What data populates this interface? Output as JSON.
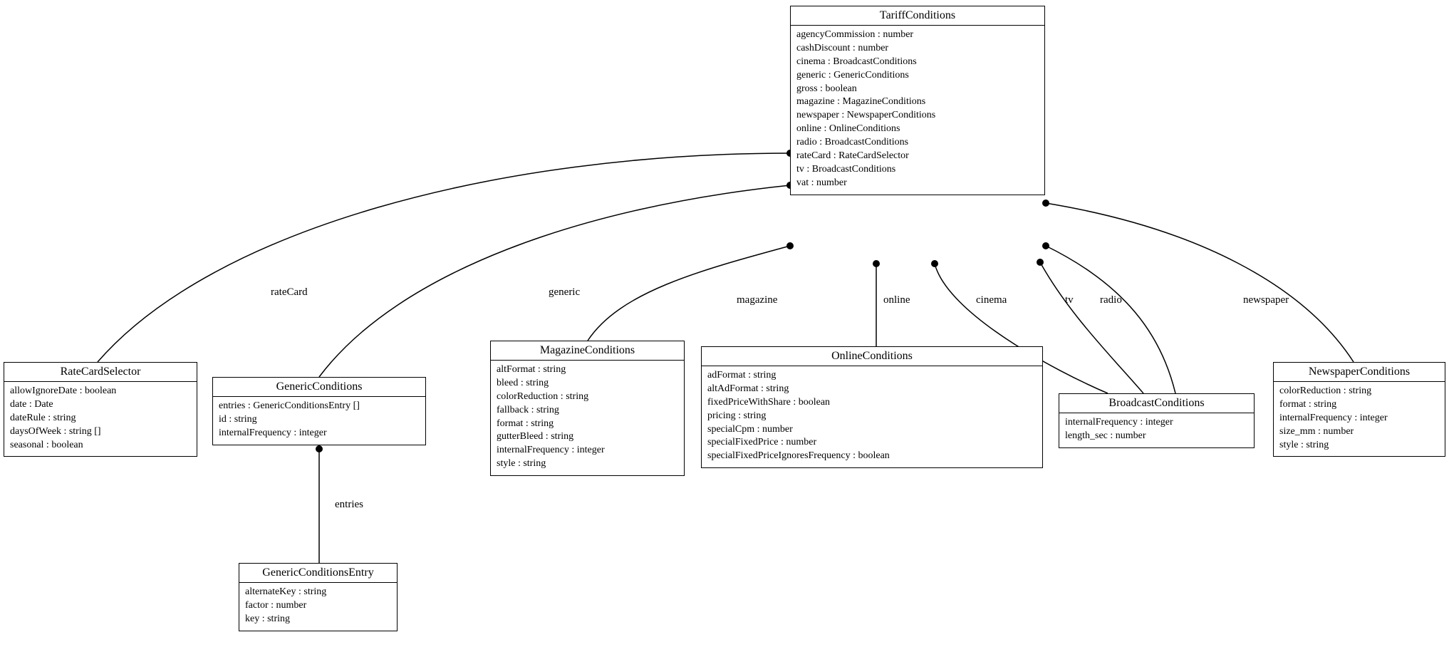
{
  "classes": {
    "tariff": {
      "name": "TariffConditions",
      "attrs": [
        "agencyCommission : number",
        "cashDiscount : number",
        "cinema : BroadcastConditions",
        "generic : GenericConditions",
        "gross : boolean",
        "magazine : MagazineConditions",
        "newspaper : NewspaperConditions",
        "online : OnlineConditions",
        "radio : BroadcastConditions",
        "rateCard : RateCardSelector",
        "tv : BroadcastConditions",
        "vat : number"
      ]
    },
    "ratecard": {
      "name": "RateCardSelector",
      "attrs": [
        "allowIgnoreDate : boolean",
        "date : Date",
        "dateRule : string",
        "daysOfWeek : string []",
        "seasonal : boolean"
      ]
    },
    "generic": {
      "name": "GenericConditions",
      "attrs": [
        "entries : GenericConditionsEntry []",
        "id : string",
        "internalFrequency : integer"
      ]
    },
    "genericEntry": {
      "name": "GenericConditionsEntry",
      "attrs": [
        "alternateKey : string",
        "factor : number",
        "key : string"
      ]
    },
    "magazine": {
      "name": "MagazineConditions",
      "attrs": [
        "altFormat : string",
        "bleed : string",
        "colorReduction : string",
        "fallback : string",
        "format : string",
        "gutterBleed : string",
        "internalFrequency : integer",
        "style : string"
      ]
    },
    "online": {
      "name": "OnlineConditions",
      "attrs": [
        "adFormat : string",
        "altAdFormat : string",
        "fixedPriceWithShare : boolean",
        "pricing : string",
        "specialCpm : number",
        "specialFixedPrice : number",
        "specialFixedPriceIgnoresFrequency : boolean"
      ]
    },
    "broadcast": {
      "name": "BroadcastConditions",
      "attrs": [
        "internalFrequency : integer",
        "length_sec : number"
      ]
    },
    "newspaper": {
      "name": "NewspaperConditions",
      "attrs": [
        "colorReduction : string",
        "format : string",
        "internalFrequency : integer",
        "size_mm : number",
        "style : string"
      ]
    }
  },
  "edgeLabels": {
    "rateCard": "rateCard",
    "generic": "generic",
    "magazine": "magazine",
    "online": "online",
    "cinema": "cinema",
    "tv": "tv",
    "radio": "radio",
    "newspaper": "newspaper",
    "entries": "entries"
  }
}
